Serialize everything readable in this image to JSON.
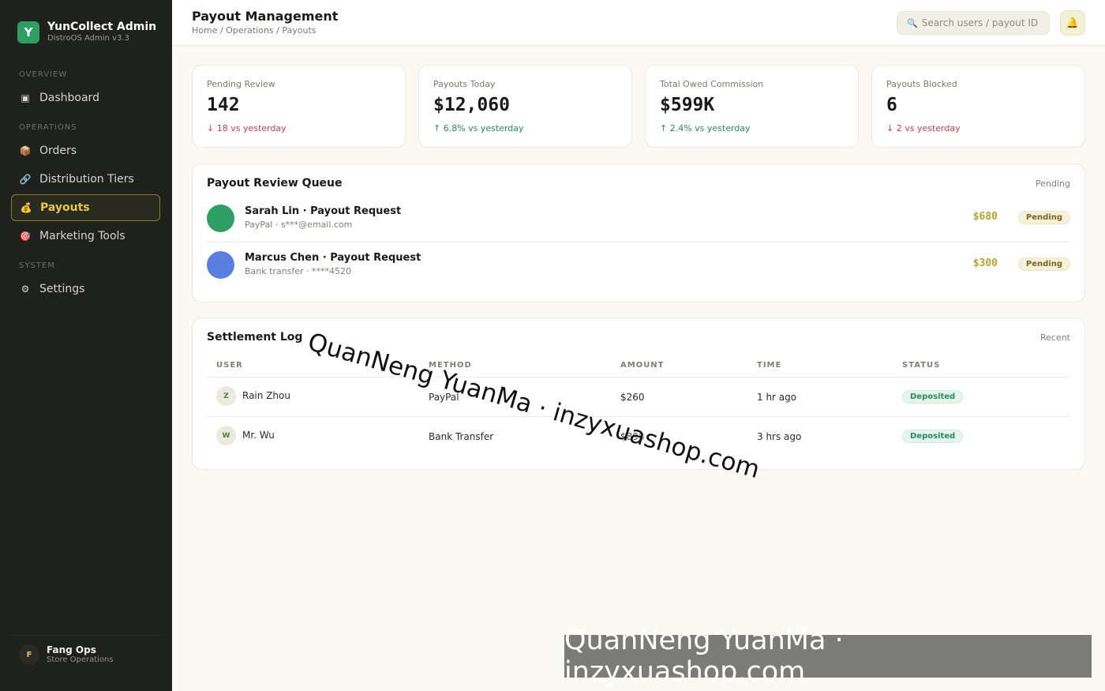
{
  "brand": {
    "logo_letter": "Y",
    "title": "YunCollect Admin",
    "subtitle": "DistroOS Admin v3.3"
  },
  "nav": {
    "sections": [
      "OVERVIEW",
      "OPERATIONS",
      "SYSTEM"
    ],
    "items": [
      {
        "label": "Dashboard",
        "icon": "▣",
        "icon_name": "dashboard-icon"
      },
      {
        "label": "Orders",
        "icon": "📦",
        "icon_name": "package-icon"
      },
      {
        "label": "Distribution Tiers",
        "icon": "🔗",
        "icon_name": "link-icon"
      },
      {
        "label": "Payouts",
        "icon": "💰",
        "icon_name": "money-bag-icon",
        "active": true
      },
      {
        "label": "Marketing Tools",
        "icon": "🎯",
        "icon_name": "target-icon"
      },
      {
        "label": "Settings",
        "icon": "⚙",
        "icon_name": "gear-icon"
      }
    ]
  },
  "user": {
    "initial": "F",
    "name": "Fang Ops",
    "role": "Store Operations"
  },
  "header": {
    "title": "Payout Management",
    "breadcrumb": "Home / Operations / Payouts",
    "search_placeholder": "Search users / payout ID",
    "search_icon": "🔍",
    "bell_icon": "🔔"
  },
  "stats": [
    {
      "label": "Pending Review",
      "value": "142",
      "delta": "↓ 18 vs yesterday",
      "trend": "down"
    },
    {
      "label": "Payouts Today",
      "value": "$12,060",
      "delta": "↑ 6.8% vs yesterday",
      "trend": "up"
    },
    {
      "label": "Total Owed Commission",
      "value": "$599K",
      "delta": "↑ 2.4% vs yesterday",
      "trend": "up"
    },
    {
      "label": "Payouts Blocked",
      "value": "6",
      "delta": "↓ 2 vs yesterday",
      "trend": "down"
    }
  ],
  "queue": {
    "title": "Payout Review Queue",
    "meta": "Pending",
    "items": [
      {
        "name": "Sarah Lin · Payout Request",
        "sub": "PayPal · s***@email.com",
        "amount": "$680",
        "status": "Pending",
        "avatar_color": "#2e9e63"
      },
      {
        "name": "Marcus Chen · Payout Request",
        "sub": "Bank transfer · ****4520",
        "amount": "$300",
        "status": "Pending",
        "avatar_color": "#5b7fe0"
      }
    ]
  },
  "log": {
    "title": "Settlement Log",
    "meta": "Recent",
    "columns": [
      "USER",
      "METHOD",
      "AMOUNT",
      "TIME",
      "STATUS"
    ],
    "rows": [
      {
        "initial": "Z",
        "user": "Rain Zhou",
        "method": "PayPal",
        "amount": "$260",
        "time": "1 hr ago",
        "status": "Deposited"
      },
      {
        "initial": "W",
        "user": "Mr. Wu",
        "method": "Bank Transfer",
        "amount": "$898",
        "time": "3 hrs ago",
        "status": "Deposited"
      }
    ]
  },
  "watermark": {
    "text": "QuanNeng YuanMa · inzyxuashop.com"
  },
  "colors": {
    "sidebar_bg": "#1f211c",
    "accent_gold": "#e9c54a",
    "brand_green": "#2e9e63",
    "down_red": "#c5424f",
    "up_green": "#2a8a5c"
  }
}
